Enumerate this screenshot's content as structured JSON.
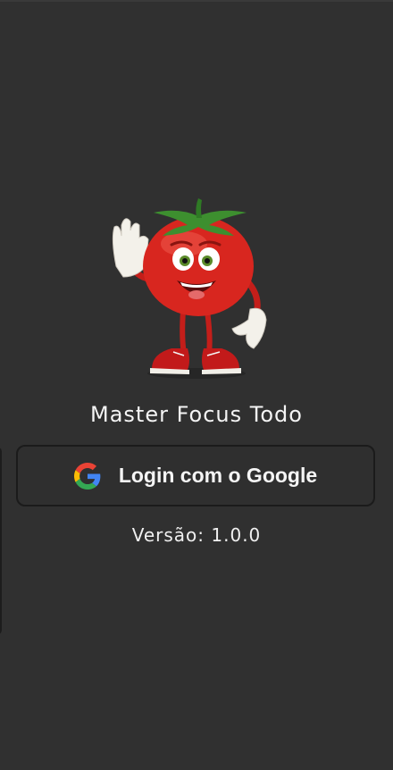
{
  "app": {
    "title": "Master Focus Todo",
    "mascot_icon": "tomato-mascot-icon"
  },
  "login": {
    "label": "Login com o Google",
    "icon": "google-icon"
  },
  "footer": {
    "version_text": "Versão: 1.0.0"
  },
  "colors": {
    "background": "#303030",
    "text": "#f4f4f4",
    "button_border": "#1b1b1b",
    "tomato_red": "#d8261f"
  }
}
